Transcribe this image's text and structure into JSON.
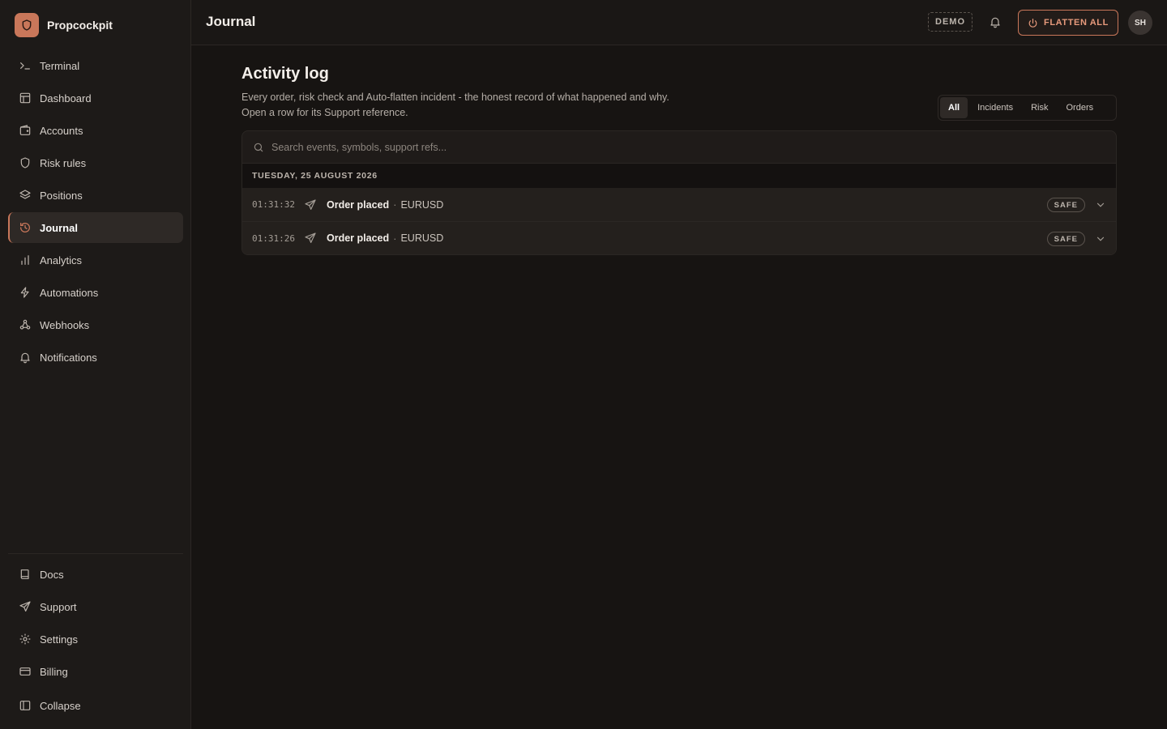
{
  "app": {
    "name": "Propcockpit"
  },
  "sidebar": {
    "items": [
      {
        "label": "Terminal",
        "icon": "terminal-icon"
      },
      {
        "label": "Dashboard",
        "icon": "layout-icon"
      },
      {
        "label": "Accounts",
        "icon": "wallet-icon"
      },
      {
        "label": "Risk rules",
        "icon": "shield-icon"
      },
      {
        "label": "Positions",
        "icon": "layers-icon"
      },
      {
        "label": "Journal",
        "icon": "history-icon",
        "active": true
      },
      {
        "label": "Analytics",
        "icon": "bar-chart-icon"
      },
      {
        "label": "Automations",
        "icon": "lightning-icon"
      },
      {
        "label": "Webhooks",
        "icon": "webhook-icon"
      },
      {
        "label": "Notifications",
        "icon": "bell-icon"
      }
    ],
    "bottom_items": [
      {
        "label": "Docs",
        "icon": "book-icon"
      },
      {
        "label": "Support",
        "icon": "send-icon"
      },
      {
        "label": "Settings",
        "icon": "gear-icon"
      },
      {
        "label": "Billing",
        "icon": "credit-card-icon"
      },
      {
        "label": "Collapse",
        "icon": "sidebar-toggle-icon"
      }
    ]
  },
  "topbar": {
    "title": "Journal",
    "demo_label": "DEMO",
    "flatten_label": "FLATTEN ALL",
    "avatar_initials": "SH"
  },
  "main": {
    "heading": "Activity log",
    "description": "Every order, risk check and Auto-flatten incident - the honest record of what happened and why. Open a row for its Support reference.",
    "filters": [
      "All",
      "Incidents",
      "Risk",
      "Orders"
    ],
    "active_filter": "All",
    "search_placeholder": "Search events, symbols, support refs...",
    "date_group": "TUESDAY, 25 AUGUST 2026",
    "rows": [
      {
        "time": "01:31:32",
        "event": "Order placed",
        "symbol": "EURUSD",
        "status": "SAFE"
      },
      {
        "time": "01:31:26",
        "event": "Order placed",
        "symbol": "EURUSD",
        "status": "SAFE"
      }
    ]
  },
  "colors": {
    "accent": "#c9775a",
    "background": "#171412",
    "sidebar": "#1d1a18"
  }
}
